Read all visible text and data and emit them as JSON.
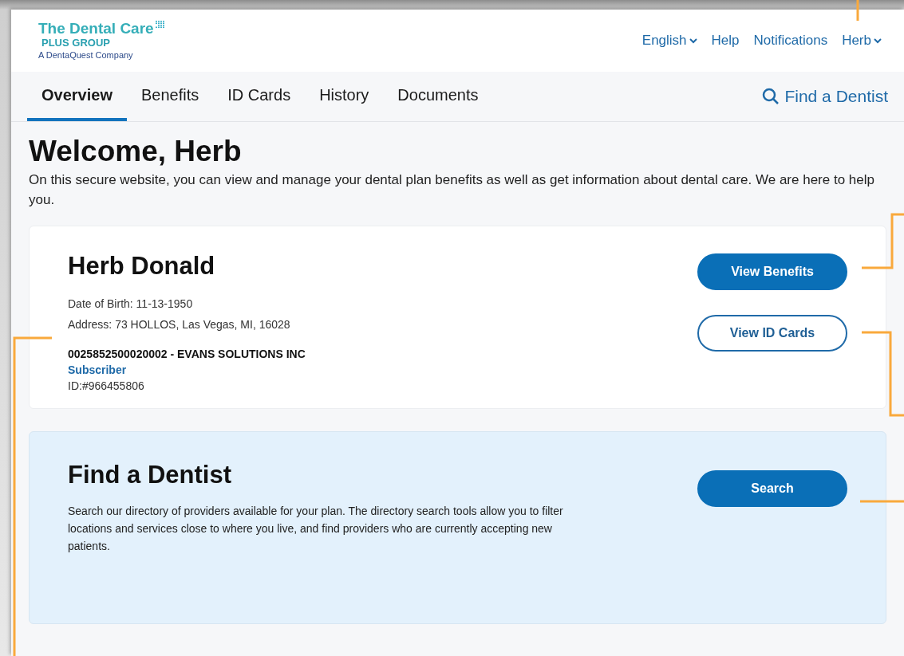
{
  "logo": {
    "title": "The Dental Care",
    "subtitle": "PLUS GROUP",
    "tagline": "A DentaQuest Company"
  },
  "top_links": [
    {
      "label": "English",
      "dropdown": true
    },
    {
      "label": "Help",
      "dropdown": false
    },
    {
      "label": "Notifications",
      "dropdown": false
    },
    {
      "label": "Herb",
      "dropdown": true
    }
  ],
  "tabs": [
    {
      "label": "Overview",
      "selected": true
    },
    {
      "label": "Benefits",
      "selected": false
    },
    {
      "label": "ID Cards",
      "selected": false
    },
    {
      "label": "History",
      "selected": false
    },
    {
      "label": "Documents",
      "selected": false
    }
  ],
  "find_dentist_link": "Find a Dentist",
  "welcome": {
    "title": "Welcome, Herb",
    "text": "On this secure website, you can view and manage your dental plan benefits as well as get information about dental care. We are here to help you."
  },
  "member_card": {
    "name": "Herb Donald",
    "details": [
      "Date of Birth: 11-13-1950",
      "Address: 73 HOLLOS, Las Vegas, MI, 16028"
    ],
    "plan": "0025852500020002 - EVANS SOLUTIONS INC",
    "role": "Subscriber",
    "id": "ID:#966455806",
    "buttons": [
      {
        "label": "View Benefits",
        "kind": "primary"
      },
      {
        "label": "View ID Cards",
        "kind": "outline"
      }
    ]
  },
  "dentist_card": {
    "title": "Find a Dentist",
    "text": "Search our directory of providers available for your plan. The directory search tools allow you to filter locations and services close to where you live, and find providers who are currently accepting new patients.",
    "buttons": [
      {
        "label": "Search",
        "kind": "primary"
      }
    ]
  }
}
